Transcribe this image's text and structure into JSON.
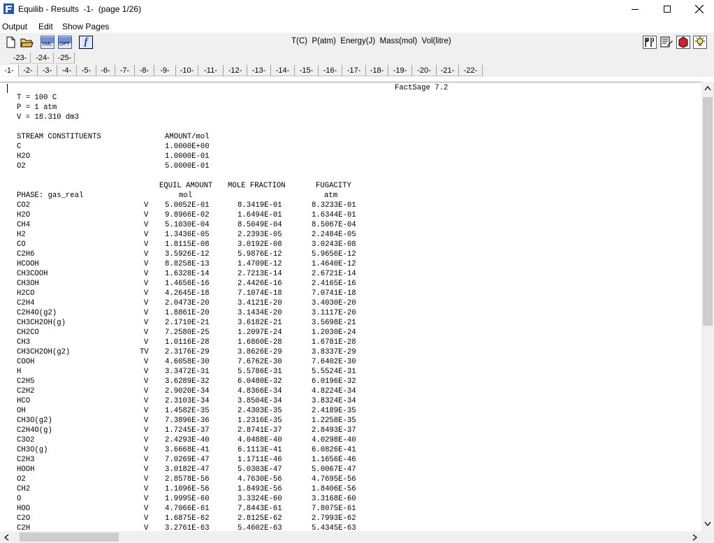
{
  "window": {
    "title": "Equilib - Results  -1-  (page 1/26)"
  },
  "menu": {
    "items": [
      "Output",
      "Edit",
      "Show Pages"
    ]
  },
  "toolbar": {
    "units": "T(C)  P(atm)  Energy(J)  Mass(mol)  Vol(litre)",
    "xml_label": "XML",
    "opt_label": "OPT",
    "f_label": "f"
  },
  "tabs": {
    "row1": [
      "-23-",
      "-24-",
      "-25-"
    ],
    "row2": [
      "-1-",
      "-2-",
      "-3-",
      "-4-",
      "-5-",
      "-6-",
      "-7-",
      "-8-",
      "-9-",
      "-10-",
      "-11-",
      "-12-",
      "-13-",
      "-14-",
      "-15-",
      "-16-",
      "-17-",
      "-18-",
      "-19-",
      "-20-",
      "-21-",
      "-22-"
    ],
    "selected": "-1-"
  },
  "results": {
    "program": "FactSage 7.2",
    "conditions": [
      "T = 100 C",
      "P = 1 atm",
      "V = 18.310 dm3"
    ],
    "stream_header": {
      "label": "STREAM CONSTITUENTS",
      "amount": "AMOUNT/mol"
    },
    "stream": [
      {
        "name": "C",
        "amount": "1.0000E+00"
      },
      {
        "name": "H2O",
        "amount": "1.0000E-01"
      },
      {
        "name": "O2",
        "amount": "5.0000E-01"
      }
    ],
    "columns": {
      "equil": "EQUIL AMOUNT",
      "equil_unit": "mol",
      "molefrac": "MOLE FRACTION",
      "fugacity": "FUGACITY",
      "fugacity_unit": "atm"
    },
    "phase_label": "PHASE: gas_real",
    "species": [
      [
        "CO2",
        "V",
        "5.0052E-01",
        "8.3419E-01",
        "8.3233E-01"
      ],
      [
        "H2O",
        "V",
        "9.8966E-02",
        "1.6494E-01",
        "1.6344E-01"
      ],
      [
        "CH4",
        "V",
        "5.1030E-04",
        "8.5049E-04",
        "8.5067E-04"
      ],
      [
        "H2",
        "V",
        "1.3436E-05",
        "2.2393E-05",
        "2.2484E-05"
      ],
      [
        "CO",
        "V",
        "1.8115E-08",
        "3.0192E-08",
        "3.0243E-08"
      ],
      [
        "C2H6",
        "V",
        "3.5926E-12",
        "5.9876E-12",
        "5.9656E-12"
      ],
      [
        "HCOOH",
        "V",
        "8.8258E-13",
        "1.4709E-12",
        "1.4640E-12"
      ],
      [
        "CH3COOH",
        "V",
        "1.6328E-14",
        "2.7213E-14",
        "2.6721E-14"
      ],
      [
        "CH3OH",
        "V",
        "1.4656E-16",
        "2.4426E-16",
        "2.4165E-16"
      ],
      [
        "H2CO",
        "V",
        "4.2645E-18",
        "7.1074E-18",
        "7.0741E-18"
      ],
      [
        "C2H4",
        "V",
        "2.0473E-20",
        "3.4121E-20",
        "3.4030E-20"
      ],
      [
        "C2H4O(g2)",
        "V",
        "1.8861E-20",
        "3.1434E-20",
        "3.1117E-20"
      ],
      [
        "CH3CH2OH(g)",
        "V",
        "2.1710E-21",
        "3.6182E-21",
        "3.5698E-21"
      ],
      [
        "CH2CO",
        "V",
        "7.2580E-25",
        "1.2097E-24",
        "1.2030E-24"
      ],
      [
        "CH3",
        "V",
        "1.0116E-28",
        "1.6860E-28",
        "1.6781E-28"
      ],
      [
        "CH3CH2OH(g2)",
        "TV",
        "2.3176E-29",
        "3.8626E-29",
        "3.8337E-29"
      ],
      [
        "COOH",
        "V",
        "4.6058E-30",
        "7.6762E-30",
        "7.6402E-30"
      ],
      [
        "H",
        "V",
        "3.3472E-31",
        "5.5786E-31",
        "5.5524E-31"
      ],
      [
        "C2H5",
        "V",
        "3.6289E-32",
        "6.0480E-32",
        "6.0196E-32"
      ],
      [
        "C2H2",
        "V",
        "2.9020E-34",
        "4.8366E-34",
        "4.8224E-34"
      ],
      [
        "HCO",
        "V",
        "2.3103E-34",
        "3.8504E-34",
        "3.8324E-34"
      ],
      [
        "OH",
        "V",
        "1.4582E-35",
        "2.4303E-35",
        "2.4189E-35"
      ],
      [
        "CH3O(g2)",
        "V",
        "7.3896E-36",
        "1.2316E-35",
        "1.2258E-35"
      ],
      [
        "C2H4O(g)",
        "V",
        "1.7245E-37",
        "2.8741E-37",
        "2.8493E-37"
      ],
      [
        "C3O2",
        "V",
        "2.4293E-40",
        "4.0488E-40",
        "4.0298E-40"
      ],
      [
        "CH3O(g)",
        "V",
        "3.6668E-41",
        "6.1113E-41",
        "6.0826E-41"
      ],
      [
        "C2H3",
        "V",
        "7.0269E-47",
        "1.1711E-46",
        "1.1656E-46"
      ],
      [
        "HOOH",
        "V",
        "3.0182E-47",
        "5.0303E-47",
        "5.0067E-47"
      ],
      [
        "O2",
        "V",
        "2.8578E-56",
        "4.7630E-56",
        "4.7695E-56"
      ],
      [
        "CH2",
        "V",
        "1.1096E-56",
        "1.8493E-56",
        "1.8406E-56"
      ],
      [
        "O",
        "V",
        "1.9995E-60",
        "3.3324E-60",
        "3.3168E-60"
      ],
      [
        "HOO",
        "V",
        "4.7066E-61",
        "7.8443E-61",
        "7.8075E-61"
      ],
      [
        "C2O",
        "V",
        "1.6875E-62",
        "2.8125E-62",
        "2.7993E-62"
      ],
      [
        "C2H",
        "V",
        "3.2761E-63",
        "5.4602E-63",
        "5.4345E-63"
      ]
    ]
  },
  "icons": [
    "app-icon",
    "new-file-icon",
    "open-folder-icon",
    "xml-icon",
    "opt-icon",
    "factsage-f-icon",
    "utensils-icon",
    "edit-sheet-icon",
    "red-stop-icon",
    "lightbulb-icon"
  ]
}
